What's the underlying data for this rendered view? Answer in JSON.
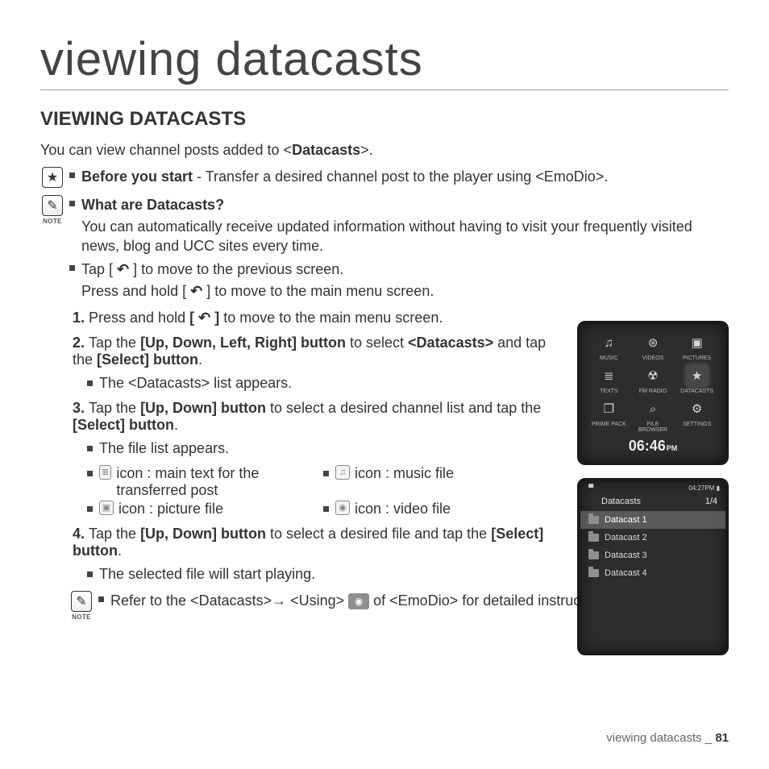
{
  "chapter_title": "viewing datacasts",
  "section_title": "VIEWING DATACASTS",
  "intro_pre": "You can view channel posts added to <",
  "intro_bold": "Datacasts",
  "intro_post": ">.",
  "tip": {
    "before_label": "Before you start",
    "before_text": " - Transfer a desired channel post to the player using <EmoDio>."
  },
  "note1": {
    "caption": "NOTE",
    "what_label": "What are Datacasts?",
    "what_text": "You can automatically receive updated information without having to visit your frequently visited news, blog and UCC sites every time.",
    "tap_text_a": "Tap [ ",
    "tap_text_b": " ] to move to the previous screen.",
    "hold_text_a": "Press and hold [ ",
    "hold_text_b": " ] to move to the main menu screen."
  },
  "steps": {
    "s1_a": "Press and hold ",
    "s1_b": "[ ",
    "s1_c": " ]",
    "s1_d": " to move to the main menu screen.",
    "s2_a": "Tap the ",
    "s2_b": "[Up, Down, Left, Right] button",
    "s2_c": " to select ",
    "s2_d": "<Datacasts>",
    "s2_e": " and tap the ",
    "s2_f": "[Select] button",
    "s2_g": ".",
    "s2_sub": "The <Datacasts> list appears.",
    "s3_a": "Tap the ",
    "s3_b": "[Up, Down] button",
    "s3_c": " to select a desired channel list and tap the ",
    "s3_d": "[Select] button",
    "s3_e": ".",
    "s3_sub": "The file list appears.",
    "icon_text": " icon : main text for the transferred post",
    "icon_pic": " icon : picture file",
    "icon_music": " icon : music file",
    "icon_video": " icon : video file",
    "s4_a": "Tap the ",
    "s4_b": "[Up, Down] button",
    "s4_c": " to select a desired file and tap the ",
    "s4_d": "[Select] button",
    "s4_e": ".",
    "s4_sub": "The selected file will start playing."
  },
  "note2": {
    "caption": "NOTE",
    "text_a": "Refer to the <Datacasts>→ <Using>  ",
    "text_b": "  of <EmoDio> for detailed instructions."
  },
  "menu": {
    "items": [
      {
        "label": "MUSIC",
        "glyph": "♫"
      },
      {
        "label": "VIDEOS",
        "glyph": "⊛"
      },
      {
        "label": "PICTURES",
        "glyph": "▣"
      },
      {
        "label": "TEXTS",
        "glyph": "≣"
      },
      {
        "label": "FM RADIO",
        "glyph": "☢"
      },
      {
        "label": "DATACASTS",
        "glyph": "★"
      },
      {
        "label": "PRIME PACK",
        "glyph": "❐"
      },
      {
        "label": "FILE BROWSER",
        "glyph": "⌕"
      },
      {
        "label": "SETTINGS",
        "glyph": "⚙"
      }
    ],
    "clock": "06:46",
    "ampm": "PM"
  },
  "listScreen": {
    "status_time": "04:27PM",
    "title": "Datacasts",
    "counter": "1/4",
    "items": [
      "Datacast 1",
      "Datacast 2",
      "Datacast 3",
      "Datacast 4"
    ]
  },
  "footer": {
    "label": "viewing datacasts _ ",
    "page": "81"
  }
}
